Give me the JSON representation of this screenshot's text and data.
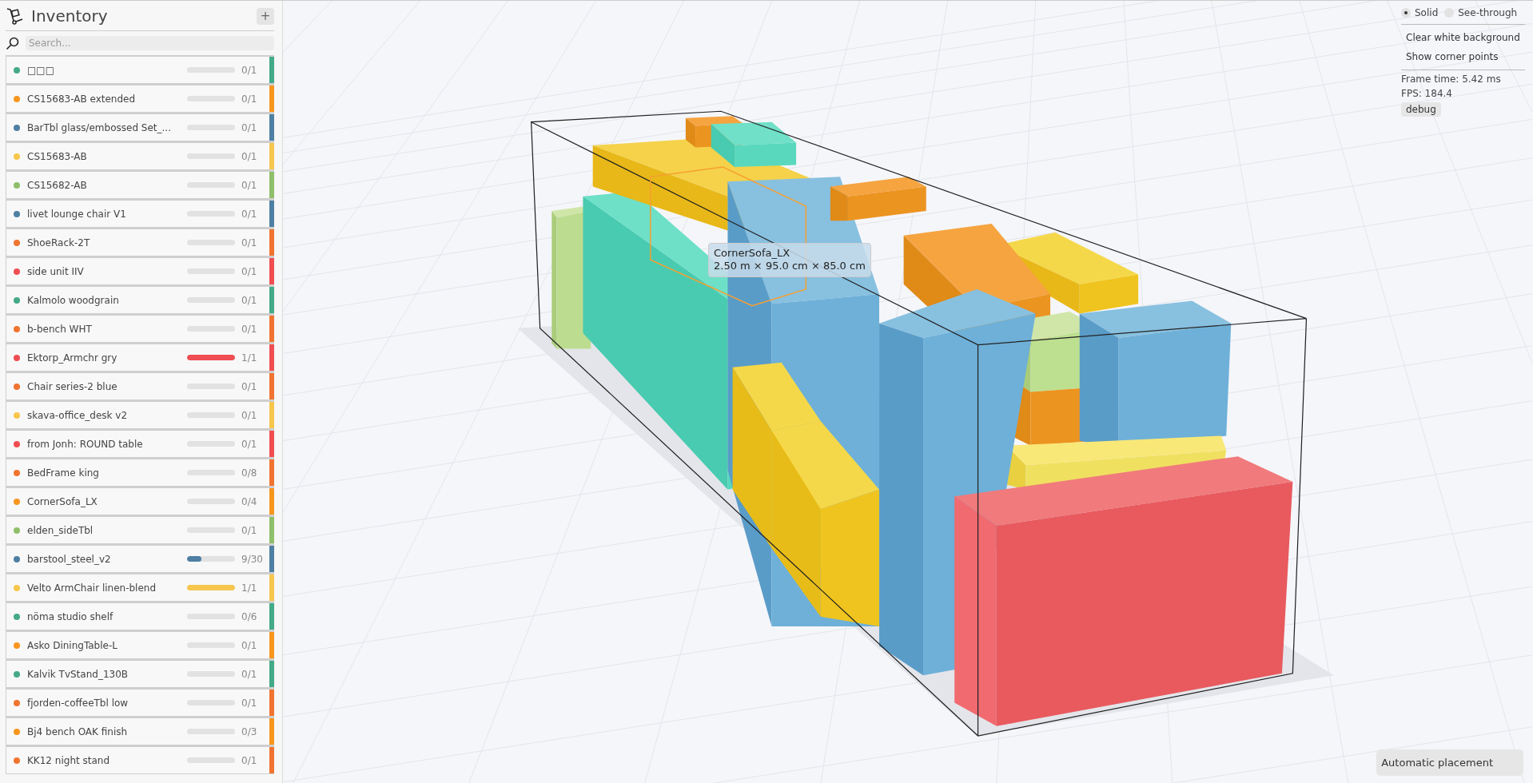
{
  "sidebar": {
    "title": "Inventory",
    "add_button": "+",
    "search": {
      "placeholder": "Search..."
    },
    "items": [
      {
        "name": "□□□",
        "count": "0/1",
        "level": 0,
        "color": "#44aa88"
      },
      {
        "name": "CS15683-AB extended",
        "count": "0/1",
        "level": 0,
        "color": "#f7961e"
      },
      {
        "name": "BarTbl glass/embossed Set_...",
        "count": "0/1",
        "level": 0,
        "color": "#4f7fa3"
      },
      {
        "name": "CS15683-AB",
        "count": "0/1",
        "level": 0,
        "color": "#f7c64c"
      },
      {
        "name": "CS15682-AB",
        "count": "0/1",
        "level": 0,
        "color": "#8fbf6a"
      },
      {
        "name": "livet lounge chair V1",
        "count": "0/1",
        "level": 0,
        "color": "#4f7fa3"
      },
      {
        "name": "ShoeRack-2T",
        "count": "0/1",
        "level": 0,
        "color": "#f07430"
      },
      {
        "name": "side unit IIV",
        "count": "0/1",
        "level": 0,
        "color": "#f04e52"
      },
      {
        "name": "Kalmolo woodgrain",
        "count": "0/1",
        "level": 0,
        "color": "#44aa88"
      },
      {
        "name": "b-bench WHT",
        "count": "0/1",
        "level": 0,
        "color": "#f07430"
      },
      {
        "name": "Ektorp_Armchr gry",
        "count": "1/1",
        "level": 1,
        "color": "#f04e52"
      },
      {
        "name": "Chair series-2 blue",
        "count": "0/1",
        "level": 0,
        "color": "#f07430"
      },
      {
        "name": "skava-office_desk v2",
        "count": "0/1",
        "level": 0,
        "color": "#f7c64c"
      },
      {
        "name": "from Jonh: ROUND table",
        "count": "0/1",
        "level": 0,
        "color": "#f04e52"
      },
      {
        "name": "BedFrame king",
        "count": "0/8",
        "level": 0,
        "color": "#f07430"
      },
      {
        "name": "CornerSofa_LX",
        "count": "0/4",
        "level": 0,
        "color": "#f7961e"
      },
      {
        "name": "elden_sideTbl",
        "count": "0/1",
        "level": 0,
        "color": "#8fbf6a"
      },
      {
        "name": "barstool_steel_v2",
        "count": "9/30",
        "level": 0.3,
        "color": "#4f7fa3"
      },
      {
        "name": "Velto ArmChair linen-blend",
        "count": "1/1",
        "level": 1,
        "color": "#f7c64c"
      },
      {
        "name": "nöma studio shelf",
        "count": "0/6",
        "level": 0,
        "color": "#44aa88"
      },
      {
        "name": "Asko DiningTable-L",
        "count": "0/1",
        "level": 0,
        "color": "#f7961e"
      },
      {
        "name": "Kalvik TvStand_130B",
        "count": "0/1",
        "level": 0,
        "color": "#44aa88"
      },
      {
        "name": "fjorden-coffeeTbl low",
        "count": "0/1",
        "level": 0,
        "color": "#f07430"
      },
      {
        "name": "Bj4 bench OAK finish",
        "count": "0/3",
        "level": 0,
        "color": "#f7961e"
      },
      {
        "name": "KK12 night stand",
        "count": "0/1",
        "level": 0,
        "color": "#f07430"
      }
    ]
  },
  "view_options": {
    "modes": [
      {
        "label": "Solid",
        "selected": true
      },
      {
        "label": "See-through",
        "selected": false
      }
    ],
    "actions": [
      "Clear white background",
      "Show corner points"
    ],
    "stats": [
      "Frame time: 5.42 ms",
      "FPS: 184.4"
    ],
    "debug_button": "debug"
  },
  "tooltip": {
    "title": "CornerSofa_LX",
    "dimensions": "2.50 m × 95.0 cm × 85.0 cm"
  },
  "placement_button": "Automatic placement"
}
